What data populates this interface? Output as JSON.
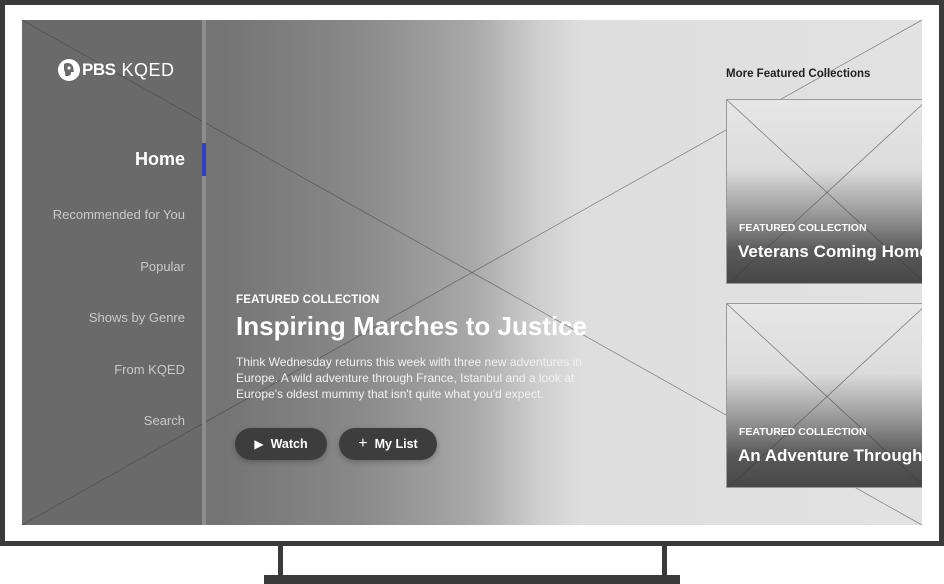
{
  "brand": {
    "logo_mark": "PBS",
    "station": "KQED"
  },
  "nav": {
    "items": [
      {
        "label": "Home",
        "active": true
      },
      {
        "label": "Recommended for You",
        "active": false
      },
      {
        "label": "Popular",
        "active": false
      },
      {
        "label": "Shows by Genre",
        "active": false
      },
      {
        "label": "From KQED",
        "active": false
      },
      {
        "label": "Search",
        "active": false
      }
    ]
  },
  "hero": {
    "eyebrow": "FEATURED COLLECTION",
    "title": "Inspiring Marches to Justice",
    "description": "Think Wednesday returns this week with three new adventures in Europe. A wild adventure through France, Istanbul and a look at Europe's oldest mummy that isn't quite what you'd expect.",
    "watch_label": "Watch",
    "mylist_label": "My List",
    "watch_icon": "play-icon",
    "mylist_icon": "plus-icon"
  },
  "featured": {
    "heading": "More Featured Collections",
    "cards": [
      {
        "eyebrow": "FEATURED COLLECTION",
        "title": "Veterans Coming Home"
      },
      {
        "eyebrow": "FEATURED COLLECTION",
        "title": "An Adventure Through"
      }
    ]
  },
  "colors": {
    "active_indicator": "#2f3fbf",
    "button_bg": "#3d3d3d",
    "frame": "#3a3a3a"
  }
}
